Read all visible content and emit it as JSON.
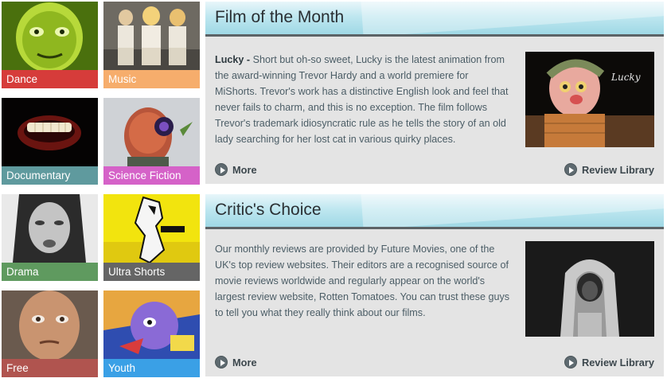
{
  "categories": [
    {
      "label": "Dance",
      "color": "#d63c3a"
    },
    {
      "label": "Music",
      "color": "#f6ad6c"
    },
    {
      "label": "Documentary",
      "color": "#5f9a9e"
    },
    {
      "label": "Science Fiction",
      "color": "#d562c8"
    },
    {
      "label": "Drama",
      "color": "#5f9a5f"
    },
    {
      "label": "Ultra Shorts",
      "color": "#656565"
    },
    {
      "label": "Free",
      "color": "#b0544f"
    },
    {
      "label": "Youth",
      "color": "#3aa0e6"
    }
  ],
  "film_of_month": {
    "title": "Film of the Month",
    "lead": "Lucky -",
    "body": " Short but oh-so sweet, Lucky is the latest animation from the award-winning Trevor Hardy and a world premiere for MiShorts. Trevor's work has a distinctive English look and feel that never fails to charm, and this is no exception. The film follows Trevor's trademark idiosyncratic rule as he tells the story of an old lady searching for her lost cat in various quirky places.",
    "image_caption": "Lucky",
    "more_label": "More",
    "library_label": "Review Library"
  },
  "critics_choice": {
    "title": "Critic's Choice",
    "body": "Our monthly reviews are provided by Future Movies, one of the UK's top review websites. Their editors are a recognised source of movie reviews worldwide and regularly appear on the world's largest review website, Rotten Tomatoes. You can trust these guys to tell you what they really think about our films.",
    "more_label": "More",
    "library_label": "Review Library"
  }
}
